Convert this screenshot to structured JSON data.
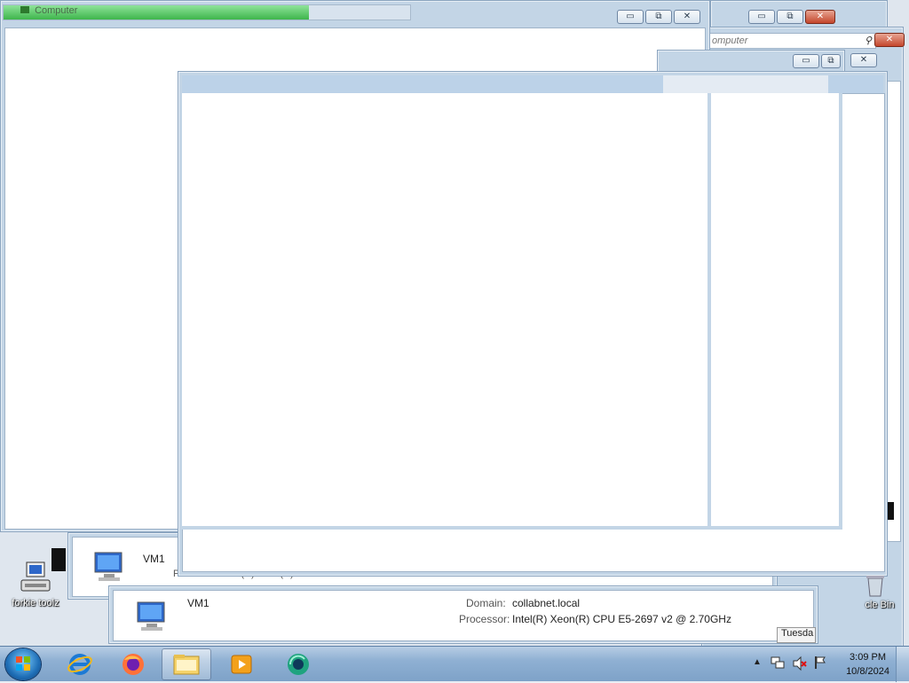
{
  "desktop": {
    "icons": [
      {
        "label": "forkie toolz",
        "icon": "computer-icon"
      },
      {
        "label": "cle Bin",
        "icon": "recycle-bin-icon"
      }
    ]
  },
  "windows": {
    "back_title": "Computer",
    "search_placeholder": "omputer",
    "system_items": [
      {
        "name": "VM1"
      },
      {
        "name": "VM1"
      }
    ],
    "processor_partial": "Processor: Intel(R) Xeon(R) CPU E5-2...",
    "domain_label": "Domain:",
    "domain_value": "collabnet.local",
    "processor_label": "Processor:",
    "processor_value": "Intel(R) Xeon(R) CPU E5-2697 v2 @ 2.70GHz",
    "cut_button": "Tuesda"
  },
  "controls": {
    "minimize": "▭",
    "maximize": "⧉",
    "close": "✕"
  },
  "taskbar": {
    "pinned": [
      {
        "name": "internet-explorer"
      },
      {
        "name": "firefox"
      },
      {
        "name": "windows-explorer",
        "active": true
      },
      {
        "name": "media-player"
      },
      {
        "name": "app-sync"
      }
    ],
    "tray": {
      "time": "3:09 PM",
      "date": "10/8/2024"
    }
  },
  "colors": {
    "taskbar": "#8fb0d3",
    "frame": "#c3d5e6",
    "progress": "#5fcf6a"
  },
  "progress": {
    "value_percent": 75
  }
}
